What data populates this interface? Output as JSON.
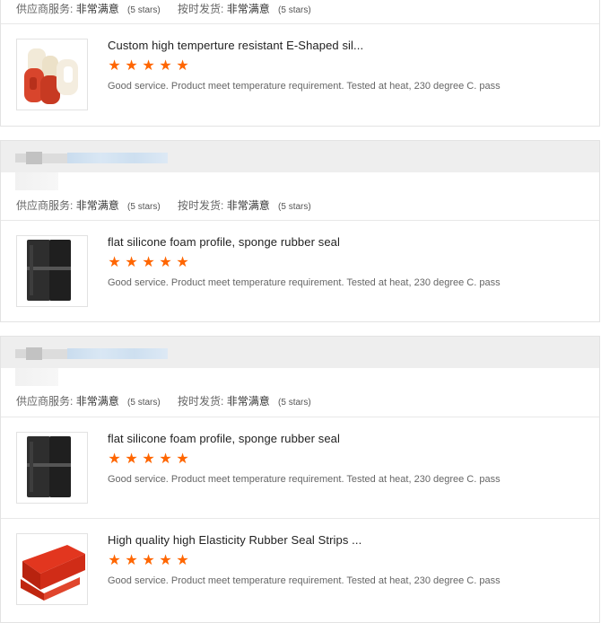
{
  "labels": {
    "supplier_service": "供应商服务:",
    "on_time_delivery": "按时发货:"
  },
  "rating_value": "非常满意",
  "rating_stars_text": "(5 stars)",
  "review_text": "Good service. Product meet temperature requirement.  Tested at heat, 230 degree C.  pass",
  "star_glyph": "★",
  "star_color": "#ff6600",
  "products": [
    {
      "title": "Custom high temperture resistant E-Shaped sil...",
      "rating": 5,
      "image": "e-shaped-silicone-seal-image"
    },
    {
      "title": "flat silicone foam profile, sponge rubber seal",
      "rating": 5,
      "image": "black-foam-profile-image"
    },
    {
      "title": "flat silicone foam profile, sponge rubber seal",
      "rating": 5,
      "image": "black-foam-profile-image"
    },
    {
      "title": "High quality high Elasticity Rubber Seal Strips ...",
      "rating": 5,
      "image": "red-rubber-strip-image"
    }
  ]
}
